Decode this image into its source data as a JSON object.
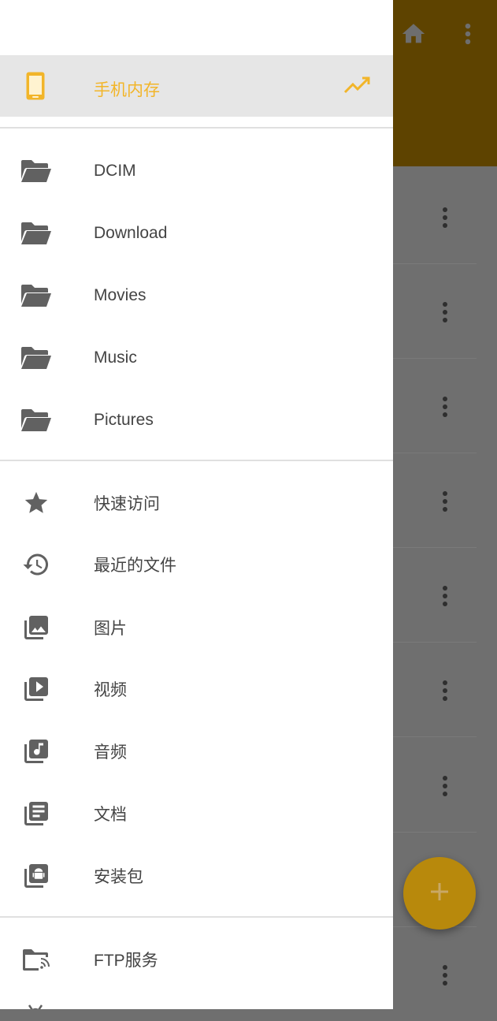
{
  "colors": {
    "accent": "#f2b529",
    "drawer_bg": "#ffffff",
    "selected_bg": "#e6e6e6",
    "toolbar_dimmed": "#5e4300",
    "icon_gray": "#616161",
    "text": "#444444"
  },
  "storage": {
    "label": "手机内存",
    "icon": "phone-icon",
    "action_icon": "trending-icon"
  },
  "folders": [
    {
      "label": "DCIM",
      "icon": "folder-open-icon"
    },
    {
      "label": "Download",
      "icon": "folder-open-icon"
    },
    {
      "label": "Movies",
      "icon": "folder-open-icon"
    },
    {
      "label": "Music",
      "icon": "folder-open-icon"
    },
    {
      "label": "Pictures",
      "icon": "folder-open-icon"
    }
  ],
  "categories": [
    {
      "label": "快速访问",
      "icon": "star-icon"
    },
    {
      "label": "最近的文件",
      "icon": "history-icon"
    },
    {
      "label": "图片",
      "icon": "image-library-icon"
    },
    {
      "label": "视频",
      "icon": "video-library-icon"
    },
    {
      "label": "音频",
      "icon": "audio-library-icon"
    },
    {
      "label": "文档",
      "icon": "document-library-icon"
    },
    {
      "label": "安装包",
      "icon": "apk-library-icon"
    }
  ],
  "services": [
    {
      "label": "FTP服务",
      "icon": "ftp-folder-icon"
    }
  ],
  "background": {
    "toolbar_icons": [
      "home-icon",
      "more-vert-icon"
    ],
    "fab_icon": "add-icon"
  }
}
